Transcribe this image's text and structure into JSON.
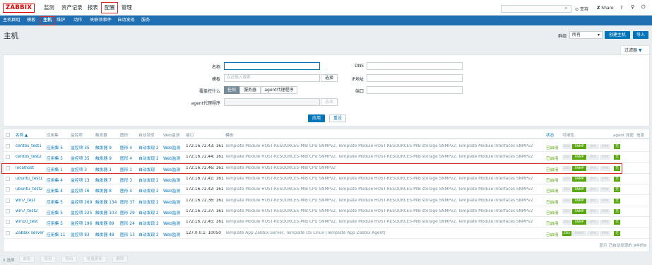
{
  "app": {
    "logo": "ZABBIX"
  },
  "topmenu": [
    "监测",
    "资产记录",
    "报表",
    "配置",
    "管理"
  ],
  "topright": {
    "support": "支持",
    "share": "Share",
    "help": "?"
  },
  "submenu": [
    "主机群组",
    "模板",
    "主机",
    "维护",
    "动作",
    "关联项事件",
    "自动发现",
    "服务"
  ],
  "page": {
    "title": "主机",
    "group_label": "群组",
    "group_value": "所有",
    "create_button": "创建主机",
    "import_button": "导入"
  },
  "filter": {
    "tab_label": "过滤器",
    "name_label": "名称",
    "dns_label": "DNS",
    "template_label": "模板",
    "template_placeholder": "在此输入搜索",
    "select_button": "选择",
    "ip_label": "IP地址",
    "monitored_by_label": "覆盖控什么",
    "monitored_by_options": [
      "任何",
      "服务器",
      "agent代理程序"
    ],
    "port_label": "端口",
    "proxy_label": "agent代理程序",
    "proxy_select_button": "选择",
    "apply_button": "应用",
    "reset_button": "重设"
  },
  "table": {
    "headers": [
      "名称 ▲",
      "应用集",
      "监控项",
      "触发器",
      "图形",
      "自动发现",
      "Web监测",
      "接口",
      "模板",
      "状态",
      "可用性",
      "agent 加密",
      "信息"
    ],
    "rows": [
      {
        "name": "centos_test1",
        "apps": "应用集 5",
        "items": "监控项 35",
        "triggers": "触发器 9",
        "graphs": "图形 4",
        "discovery": "自动发现 2",
        "web": "Web监测",
        "interface": "172.16.72.43: 161",
        "templates": "Template Module HOST-RESOURCES-MIB CPU SNMPv2, Template Module HOST-RESOURCES-MIB storage SNMPv2, Template Module Interfaces SNMPv2",
        "status": "已启用",
        "avail": [
          "ZBX",
          "SNMP",
          "JMX",
          "IPMI"
        ],
        "avail_on": [
          false,
          true,
          false,
          false
        ],
        "enc": "无"
      },
      {
        "name": "centos_test2",
        "apps": "应用集 5",
        "items": "监控项 35",
        "triggers": "触发器 9",
        "graphs": "图形 4",
        "discovery": "自动发现 2",
        "web": "Web监测",
        "interface": "172.16.72.44: 161",
        "templates": "Template Module HOST-RESOURCES-MIB CPU SNMPv2, Template Module HOST-RESOURCES-MIB storage SNMPv2, Template Module Interfaces SNMPv2",
        "status": "已启用",
        "avail": [
          "ZBX",
          "SNMP",
          "JMX",
          "IPMI"
        ],
        "avail_on": [
          false,
          true,
          false,
          false
        ],
        "enc": "无"
      },
      {
        "name": "localhost",
        "apps": "应用集 1",
        "items": "监控项 3",
        "triggers": "触发器 1",
        "graphs": "图形 1",
        "discovery": "自动发现",
        "web": "Web监测",
        "interface": "172.16.72.46: 161",
        "templates": "Template Module HOST-RESOURCES-MIB CPU SNMPv2",
        "status": "已启用",
        "avail": [
          "ZBX",
          "SNMP",
          "JMX",
          "IPMI"
        ],
        "avail_on": [
          false,
          true,
          false,
          false
        ],
        "enc": "无"
      },
      {
        "name": "ubuntu_test1",
        "apps": "应用集 4",
        "items": "监控项 13",
        "triggers": "触发器 7",
        "graphs": "图形 3",
        "discovery": "自动发现 2",
        "web": "Web监测",
        "interface": "172.16.72.41: 161",
        "templates": "Template Module HOST-RESOURCES-MIB CPU SNMPv2, Template Module HOST-RESOURCES-MIB storage SNMPv2, Template Module Interfaces SNMPv2",
        "status": "已启用",
        "avail": [
          "ZBX",
          "SNMP",
          "JMX",
          "IPMI"
        ],
        "avail_on": [
          false,
          true,
          false,
          false
        ],
        "enc": "无"
      },
      {
        "name": "ubuntu_test2",
        "apps": "应用集 4",
        "items": "监控项 16",
        "triggers": "触发器 8",
        "graphs": "图形 4",
        "discovery": "自动发现 2",
        "web": "Web监测",
        "interface": "172.16.72.42: 161",
        "templates": "Template Module HOST-RESOURCES-MIB CPU SNMPv2, Template Module HOST-RESOURCES-MIB storage SNMPv2, Template Module Interfaces SNMPv2",
        "status": "已启用",
        "avail": [
          "ZBX",
          "SNMP",
          "JMX",
          "IPMI"
        ],
        "avail_on": [
          false,
          true,
          false,
          false
        ],
        "enc": "无"
      },
      {
        "name": "win7_test",
        "apps": "应用集 5",
        "items": "监控项 269",
        "triggers": "触发器 134",
        "graphs": "图形 37",
        "discovery": "自动发现 2",
        "web": "Web监测",
        "interface": "172.16.72.36: 161",
        "templates": "Template Module HOST-RESOURCES-MIB CPU SNMPv2, Template Module HOST-RESOURCES-MIB storage SNMPv2, Template Module Interfaces SNMPv2",
        "status": "已启用",
        "avail": [
          "ZBX",
          "SNMP",
          "JMX",
          "IPMI"
        ],
        "avail_on": [
          false,
          true,
          false,
          false
        ],
        "enc": "无"
      },
      {
        "name": "win7_test2",
        "apps": "应用集 5",
        "items": "监控项 225",
        "triggers": "触发器 103",
        "graphs": "图形 29",
        "discovery": "自动发现 2",
        "web": "Web监测",
        "interface": "172.16.72.37: 161",
        "templates": "Template Module HOST-RESOURCES-MIB CPU SNMPv2, Template Module HOST-RESOURCES-MIB storage SNMPv2, Template Module Interfaces SNMPv2",
        "status": "已启用",
        "avail": [
          "ZBX",
          "SNMP",
          "JMX",
          "IPMI"
        ],
        "avail_on": [
          false,
          true,
          false,
          false
        ],
        "enc": "无"
      },
      {
        "name": "win10_test",
        "apps": "应用集 5",
        "items": "监控项 196",
        "triggers": "触发器 89",
        "graphs": "图形 24",
        "discovery": "自动发现 2",
        "web": "Web监测",
        "interface": "172.16.72.45: 161",
        "templates": "Template Module HOST-RESOURCES-MIB CPU SNMPv2, Template Module HOST-RESOURCES-MIB storage SNMPv2, Template Module Interfaces SNMPv2",
        "status": "已启用",
        "avail": [
          "ZBX",
          "SNMP",
          "JMX",
          "IPMI"
        ],
        "avail_on": [
          false,
          true,
          false,
          false
        ],
        "enc": "无"
      },
      {
        "name": "Zabbix server",
        "apps": "应用集 11",
        "items": "监控项 83",
        "triggers": "触发器 48",
        "graphs": "图形 13",
        "discovery": "自动发现 2",
        "web": "Web监测",
        "interface": "127.0.0.1: 10050",
        "templates": "Template App Zabbix Server, Template OS Linux (Template App Zabbix Agent)",
        "status": "已启用",
        "avail": [
          "ZBX",
          "SNMP",
          "JMX",
          "IPMI"
        ],
        "avail_on": [
          true,
          false,
          false,
          false
        ],
        "enc": "无"
      }
    ],
    "summary": "显示 已自动发现的 9中的9"
  },
  "footer": {
    "selected": "0 选择",
    "buttons": [
      "启用",
      "禁用",
      "导出",
      "批量更新",
      "删除"
    ]
  },
  "colors": {
    "accent": "#0275b8",
    "subbar": "#1f6fb2",
    "highlight": "#d92e2e",
    "ok": "#59a80f"
  }
}
